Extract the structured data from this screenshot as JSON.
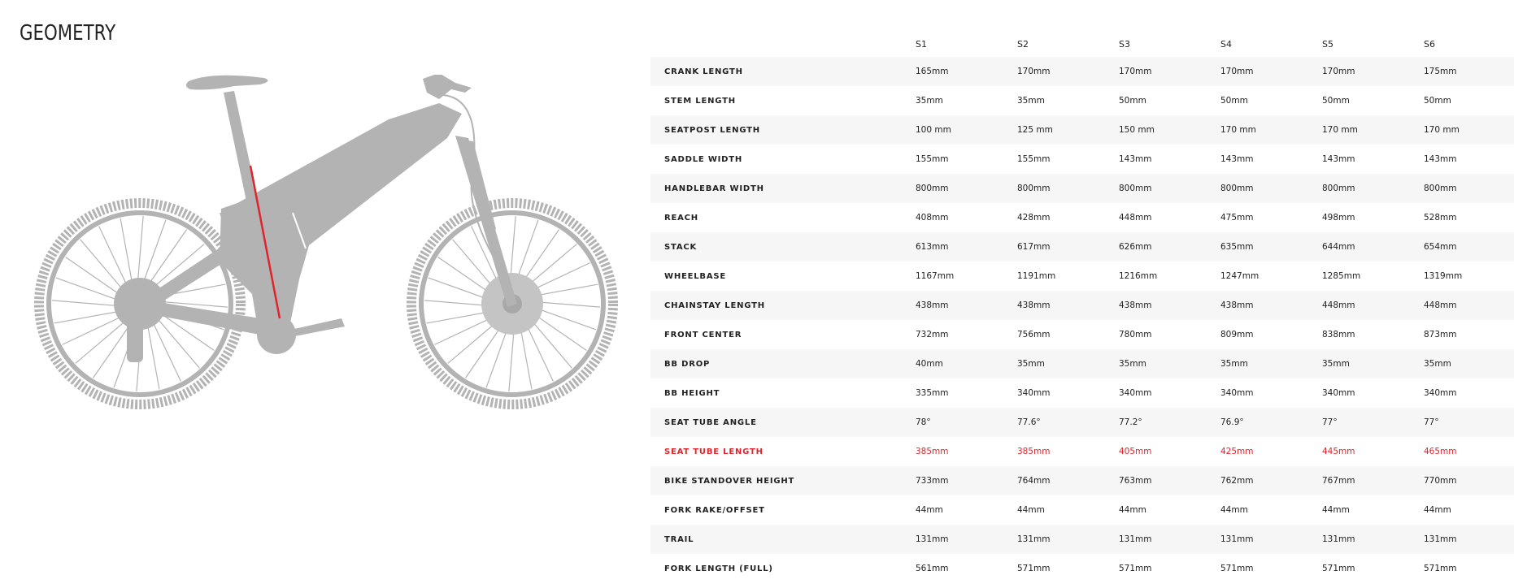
{
  "page": {
    "title": "GEOMETRY"
  },
  "colors": {
    "highlight": "#e0242b",
    "bike": "#b3b3b3",
    "stripe": "#f6f6f6"
  },
  "sizes": [
    "S1",
    "S2",
    "S3",
    "S4",
    "S5",
    "S6"
  ],
  "rows": [
    {
      "label": "CRANK LENGTH",
      "values": [
        "165mm",
        "170mm",
        "170mm",
        "170mm",
        "170mm",
        "175mm"
      ]
    },
    {
      "label": "STEM LENGTH",
      "values": [
        "35mm",
        "35mm",
        "50mm",
        "50mm",
        "50mm",
        "50mm"
      ]
    },
    {
      "label": "SEATPOST LENGTH",
      "values": [
        "100 mm",
        "125 mm",
        "150 mm",
        "170 mm",
        "170 mm",
        "170 mm"
      ]
    },
    {
      "label": "SADDLE WIDTH",
      "values": [
        "155mm",
        "155mm",
        "143mm",
        "143mm",
        "143mm",
        "143mm"
      ]
    },
    {
      "label": "HANDLEBAR WIDTH",
      "values": [
        "800mm",
        "800mm",
        "800mm",
        "800mm",
        "800mm",
        "800mm"
      ]
    },
    {
      "label": "REACH",
      "values": [
        "408mm",
        "428mm",
        "448mm",
        "475mm",
        "498mm",
        "528mm"
      ]
    },
    {
      "label": "STACK",
      "values": [
        "613mm",
        "617mm",
        "626mm",
        "635mm",
        "644mm",
        "654mm"
      ]
    },
    {
      "label": "WHEELBASE",
      "values": [
        "1167mm",
        "1191mm",
        "1216mm",
        "1247mm",
        "1285mm",
        "1319mm"
      ]
    },
    {
      "label": "CHAINSTAY LENGTH",
      "values": [
        "438mm",
        "438mm",
        "438mm",
        "438mm",
        "448mm",
        "448mm"
      ]
    },
    {
      "label": "FRONT CENTER",
      "values": [
        "732mm",
        "756mm",
        "780mm",
        "809mm",
        "838mm",
        "873mm"
      ]
    },
    {
      "label": "BB DROP",
      "values": [
        "40mm",
        "35mm",
        "35mm",
        "35mm",
        "35mm",
        "35mm"
      ]
    },
    {
      "label": "BB HEIGHT",
      "values": [
        "335mm",
        "340mm",
        "340mm",
        "340mm",
        "340mm",
        "340mm"
      ]
    },
    {
      "label": "SEAT TUBE ANGLE",
      "values": [
        "78°",
        "77.6°",
        "77.2°",
        "76.9°",
        "77°",
        "77°"
      ]
    },
    {
      "label": "SEAT TUBE LENGTH",
      "values": [
        "385mm",
        "385mm",
        "405mm",
        "425mm",
        "445mm",
        "465mm"
      ],
      "highlight": true
    },
    {
      "label": "BIKE STANDOVER HEIGHT",
      "values": [
        "733mm",
        "764mm",
        "763mm",
        "762mm",
        "767mm",
        "770mm"
      ]
    },
    {
      "label": "FORK RAKE/OFFSET",
      "values": [
        "44mm",
        "44mm",
        "44mm",
        "44mm",
        "44mm",
        "44mm"
      ]
    },
    {
      "label": "TRAIL",
      "values": [
        "131mm",
        "131mm",
        "131mm",
        "131mm",
        "131mm",
        "131mm"
      ]
    },
    {
      "label": "FORK LENGTH (FULL)",
      "values": [
        "561mm",
        "571mm",
        "571mm",
        "571mm",
        "571mm",
        "571mm"
      ]
    }
  ]
}
